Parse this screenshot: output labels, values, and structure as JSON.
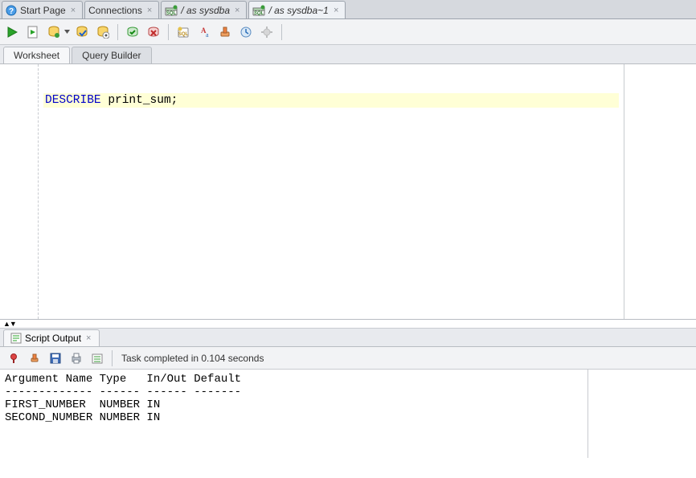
{
  "tabs": [
    {
      "icon": "help",
      "label": "Start Page",
      "italic": false
    },
    {
      "icon": "",
      "label": "Connections",
      "italic": false
    },
    {
      "icon": "sql",
      "label": "/ as sysdba",
      "italic": true
    },
    {
      "icon": "sql",
      "label": "/ as sysdba~1",
      "italic": true,
      "active": true
    }
  ],
  "subtabs": {
    "worksheet": "Worksheet",
    "querybuilder": "Query Builder"
  },
  "code": {
    "keyword": "DESCRIBE",
    "rest": " print_sum;"
  },
  "output_tab": {
    "label": "Script Output"
  },
  "status": "Task completed in 0.104 seconds",
  "output_text": "Argument Name Type   In/Out Default\n------------- ------ ------ -------\nFIRST_NUMBER  NUMBER IN\nSECOND_NUMBER NUMBER IN"
}
